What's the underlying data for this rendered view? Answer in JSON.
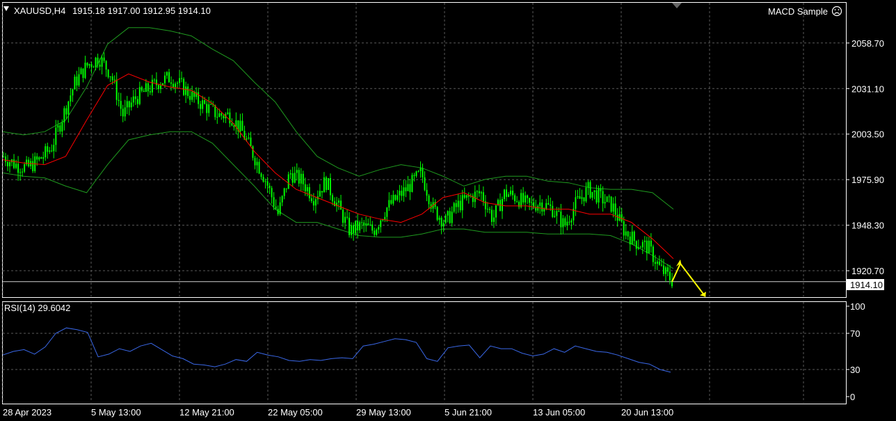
{
  "header": {
    "symbol": "XAUUSD,H4",
    "ohlc": "1915.18 1917.00 1912.95 1914.10",
    "expert": "MACD Sample"
  },
  "colors": {
    "background": "#000000",
    "grid": "#5a5a5a",
    "candle": "#00ff00",
    "bands": "#1f9a1f",
    "ma": "#ff0000",
    "rsi": "#3a68e8",
    "arrow": "#ffff00",
    "price_box": "#ffffff"
  },
  "icons": {
    "dropdown": "triangle-down-icon",
    "smiley": "frown-face-icon",
    "shift_marker": "triangle-marker-icon"
  },
  "chart_data": [
    {
      "type": "line",
      "title": "",
      "subtitle": "",
      "indicators": [
        "Bollinger Bands",
        "Moving Average"
      ],
      "y_ticks": [
        1920.7,
        1948.3,
        1975.9,
        2003.5,
        2031.1,
        2058.7
      ],
      "ylim": [
        1904.7,
        2083.5
      ],
      "current_price": "1914.10",
      "x_ticks": [
        "28 Apr 2023",
        "5 May 13:00",
        "12 May 21:00",
        "22 May 05:00",
        "29 May 13:00",
        "5 Jun 21:00",
        "13 Jun 05:00",
        "20 Jun 13:00"
      ],
      "close_path": [
        1990,
        1985,
        1983,
        1988,
        1995,
        2015,
        2035,
        2045,
        2050,
        2040,
        2015,
        2025,
        2030,
        2035,
        2038,
        2032,
        2025,
        2020,
        2015,
        2015,
        2005,
        1990,
        1975,
        1955,
        1980,
        1975,
        1965,
        1975,
        1960,
        1945,
        1948,
        1945,
        1958,
        1965,
        1972,
        1980,
        1958,
        1950,
        1960,
        1965,
        1968,
        1952,
        1968,
        1965,
        1960,
        1962,
        1958,
        1948,
        1962,
        1970,
        1965,
        1960,
        1945,
        1938,
        1935,
        1922,
        1915
      ],
      "bb_upper": [
        2005,
        2003,
        2005,
        2012,
        2032,
        2058,
        2068,
        2068,
        2066,
        2063,
        2055,
        2048,
        2035,
        2023,
        2005,
        1990,
        1983,
        1978,
        1982,
        1985,
        1983,
        1978,
        1972,
        1976,
        1978,
        1978,
        1975,
        1974,
        1971,
        1970,
        1970,
        1968,
        1958
      ],
      "bb_lower": [
        1980,
        1978,
        1977,
        1972,
        1968,
        1985,
        2000,
        2003,
        2005,
        2005,
        1998,
        1985,
        1972,
        1958,
        1950,
        1950,
        1946,
        1942,
        1941,
        1941,
        1943,
        1946,
        1946,
        1944,
        1944,
        1944,
        1943,
        1943,
        1943,
        1942,
        1937,
        1930,
        1922
      ],
      "ma_path": [
        1988,
        1986,
        1985,
        1990,
        2012,
        2033,
        2040,
        2035,
        2032,
        2030,
        2022,
        2010,
        1993,
        1980,
        1970,
        1965,
        1960,
        1955,
        1952,
        1950,
        1955,
        1965,
        1968,
        1962,
        1960,
        1960,
        1958,
        1958,
        1955,
        1955,
        1950,
        1940,
        1928
      ],
      "arrows": [
        {
          "from": [
            1914,
            1925
          ],
          "dir": "up"
        },
        {
          "from": [
            1925,
            1905
          ],
          "dir": "down"
        }
      ]
    },
    {
      "type": "line",
      "title": "RSI(14) 29.6042",
      "y_ticks": [
        0,
        30,
        70,
        100
      ],
      "ylim": [
        0,
        100
      ],
      "series": [
        {
          "name": "RSI(14)",
          "values": [
            46,
            50,
            52,
            47,
            55,
            70,
            76,
            74,
            71,
            44,
            47,
            53,
            50,
            56,
            59,
            52,
            45,
            42,
            36,
            35,
            33,
            36,
            41,
            39,
            49,
            46,
            44,
            40,
            39,
            41,
            40,
            42,
            43,
            42,
            56,
            58,
            61,
            64,
            63,
            60,
            42,
            39,
            54,
            56,
            57,
            43,
            56,
            53,
            53,
            48,
            45,
            47,
            53,
            49,
            56,
            53,
            50,
            49,
            46,
            42,
            38,
            36,
            30,
            27
          ]
        }
      ]
    }
  ]
}
